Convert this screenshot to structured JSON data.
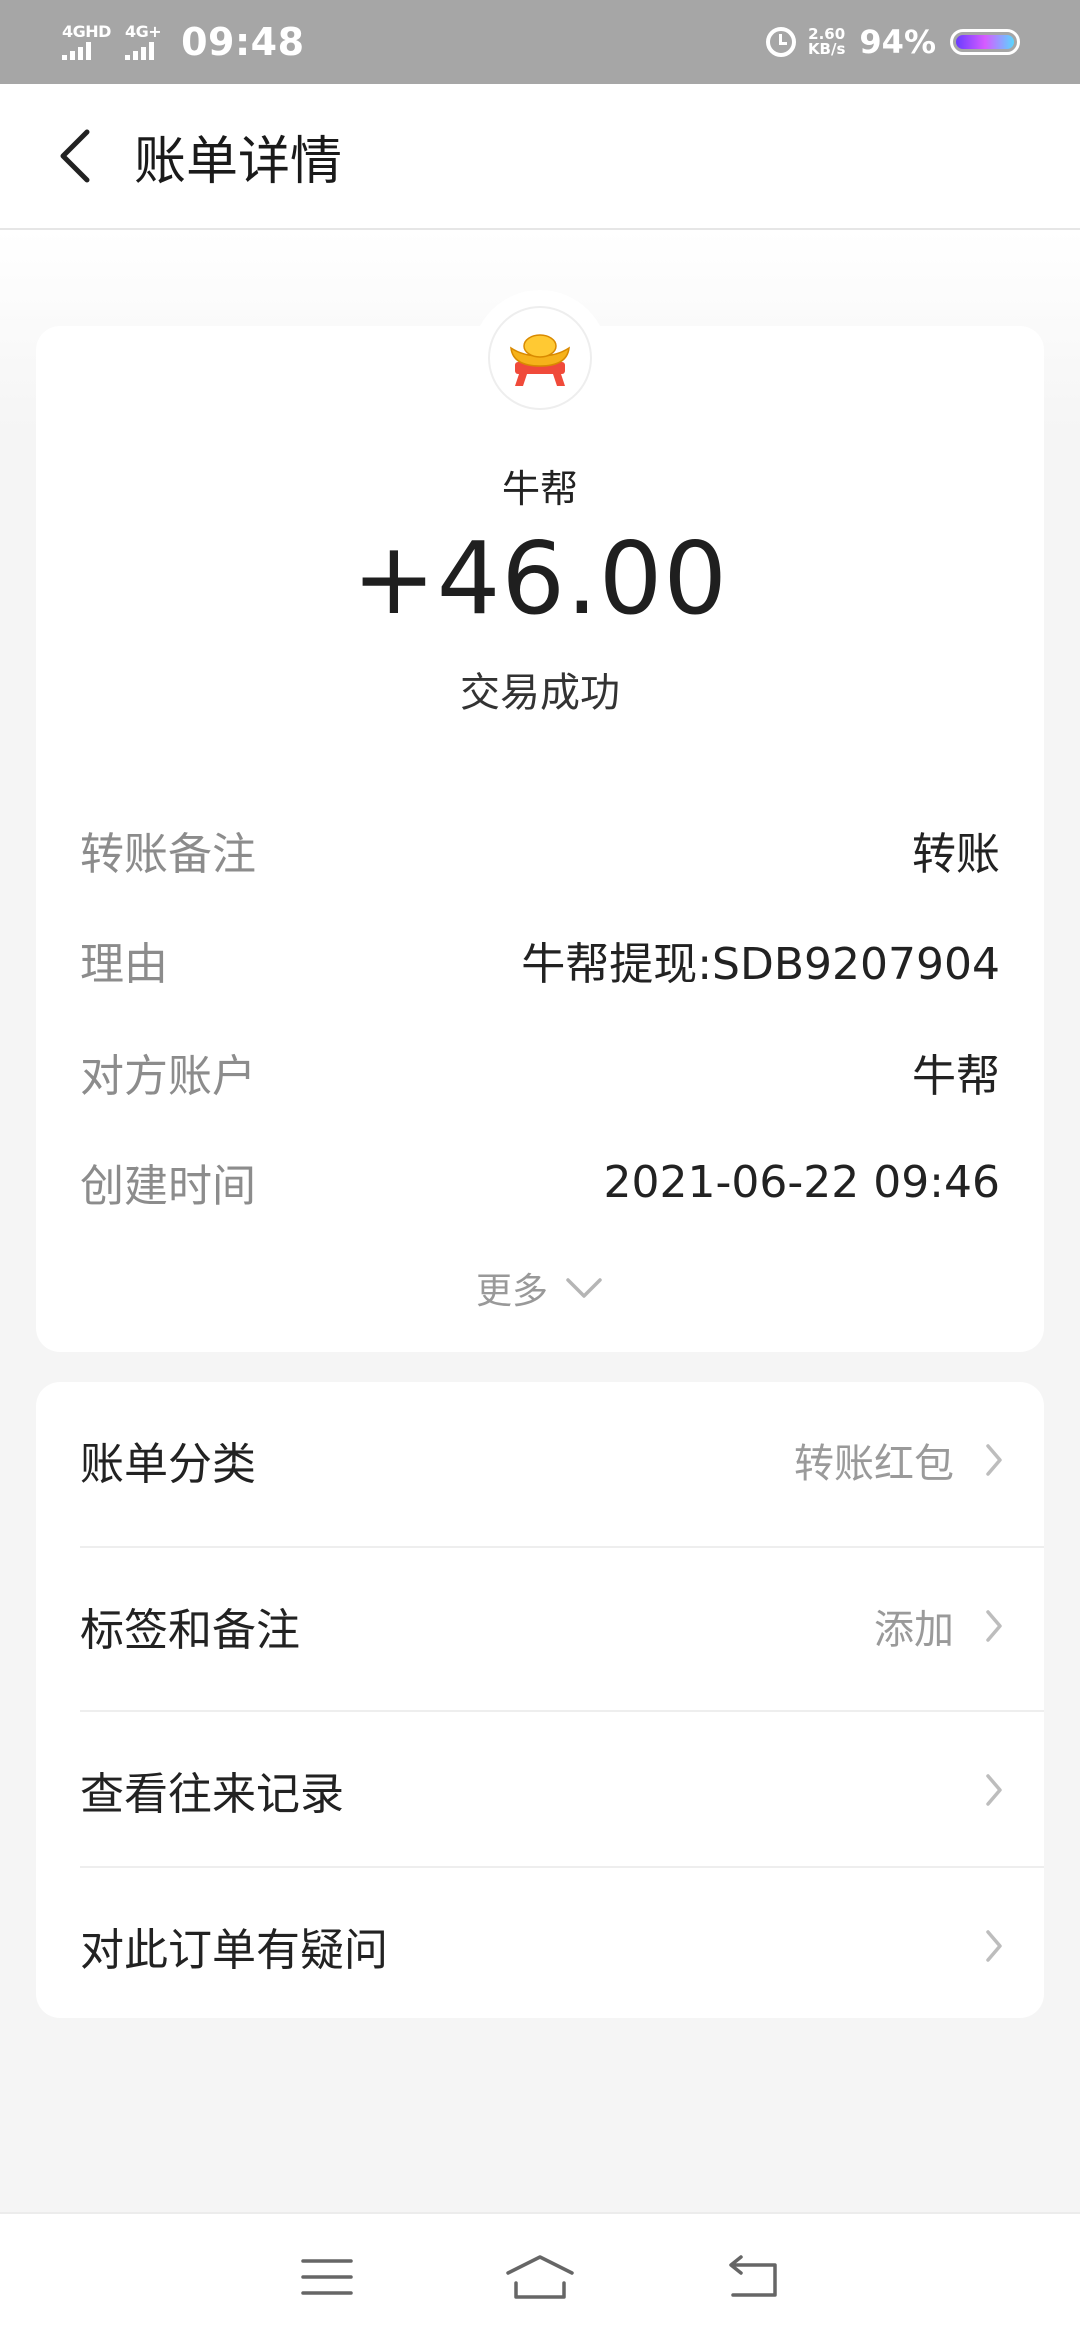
{
  "status_bar": {
    "net1": "4GHD",
    "net2": "4G+",
    "time": "09:48",
    "speed_value": "2.60",
    "speed_unit": "KB/s",
    "battery": "94%"
  },
  "header": {
    "title": "账单详情"
  },
  "summary": {
    "merchant": "牛帮",
    "amount": "+46.00",
    "status": "交易成功"
  },
  "details": [
    {
      "key": "转账备注",
      "value": "转账"
    },
    {
      "key": "理由",
      "value": "牛帮提现:SDB9207904"
    },
    {
      "key": "对方账户",
      "value": "牛帮"
    },
    {
      "key": "创建时间",
      "value": "2021-06-22 09:46"
    }
  ],
  "more_label": "更多",
  "menu": [
    {
      "label": "账单分类",
      "value": "转账红包"
    },
    {
      "label": "标签和备注",
      "value": "添加"
    },
    {
      "label": "查看往来记录",
      "value": ""
    },
    {
      "label": "对此订单有疑问",
      "value": ""
    }
  ],
  "colors": {
    "status_bar_bg": "#a6a6a6",
    "page_bg": "#f5f5f5",
    "muted_text": "#8c8c8c",
    "ingot_gold": "#f6b21a",
    "ingot_red": "#f04a3a"
  }
}
